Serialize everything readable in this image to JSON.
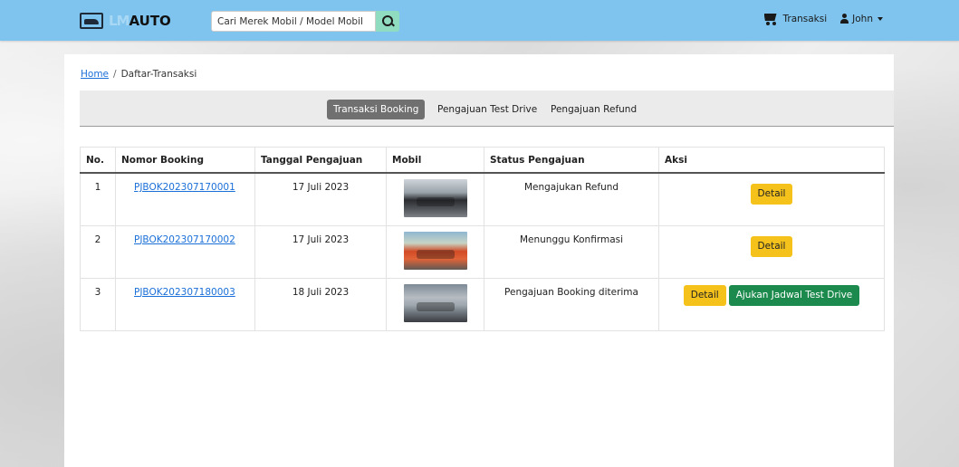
{
  "navbar": {
    "brand_faded": "LM",
    "brand_strong": "AUTO",
    "search_placeholder": "Cari Merek Mobil / Model Mobil",
    "transaksi_label": "Transaksi",
    "user_label": "John",
    "color": "#7ec4ee"
  },
  "breadcrumb": {
    "home": "Home",
    "separator": "/",
    "current": "Daftar-Transaksi"
  },
  "tabs": [
    {
      "label": "Transaksi Booking",
      "active": true
    },
    {
      "label": "Pengajuan Test Drive",
      "active": false
    },
    {
      "label": "Pengajuan Refund",
      "active": false
    }
  ],
  "table": {
    "headers": [
      "No.",
      "Nomor Booking",
      "Tanggal Pengajuan",
      "Mobil",
      "Status Pengajuan",
      "Aksi"
    ],
    "rows": [
      {
        "no": "1",
        "nomor": "PJBOK202307170001",
        "tanggal": "17 Juli 2023",
        "status": "Mengajukan Refund",
        "detail": "Detail"
      },
      {
        "no": "2",
        "nomor": "PJBOK202307170002",
        "tanggal": "17 Juli 2023",
        "status": "Menunggu Konfirmasi",
        "detail": "Detail"
      },
      {
        "no": "3",
        "nomor": "PJBOK202307180003",
        "tanggal": "18 Juli 2023",
        "status": "Pengajuan Booking diterima",
        "detail": "Detail",
        "test_drive": "Ajukan Jadwal Test Drive"
      }
    ]
  },
  "colors": {
    "detail_button": "#f5c21b",
    "test_drive_button": "#1b8a4c",
    "active_tab": "#707070",
    "link": "#1a6fd8"
  }
}
